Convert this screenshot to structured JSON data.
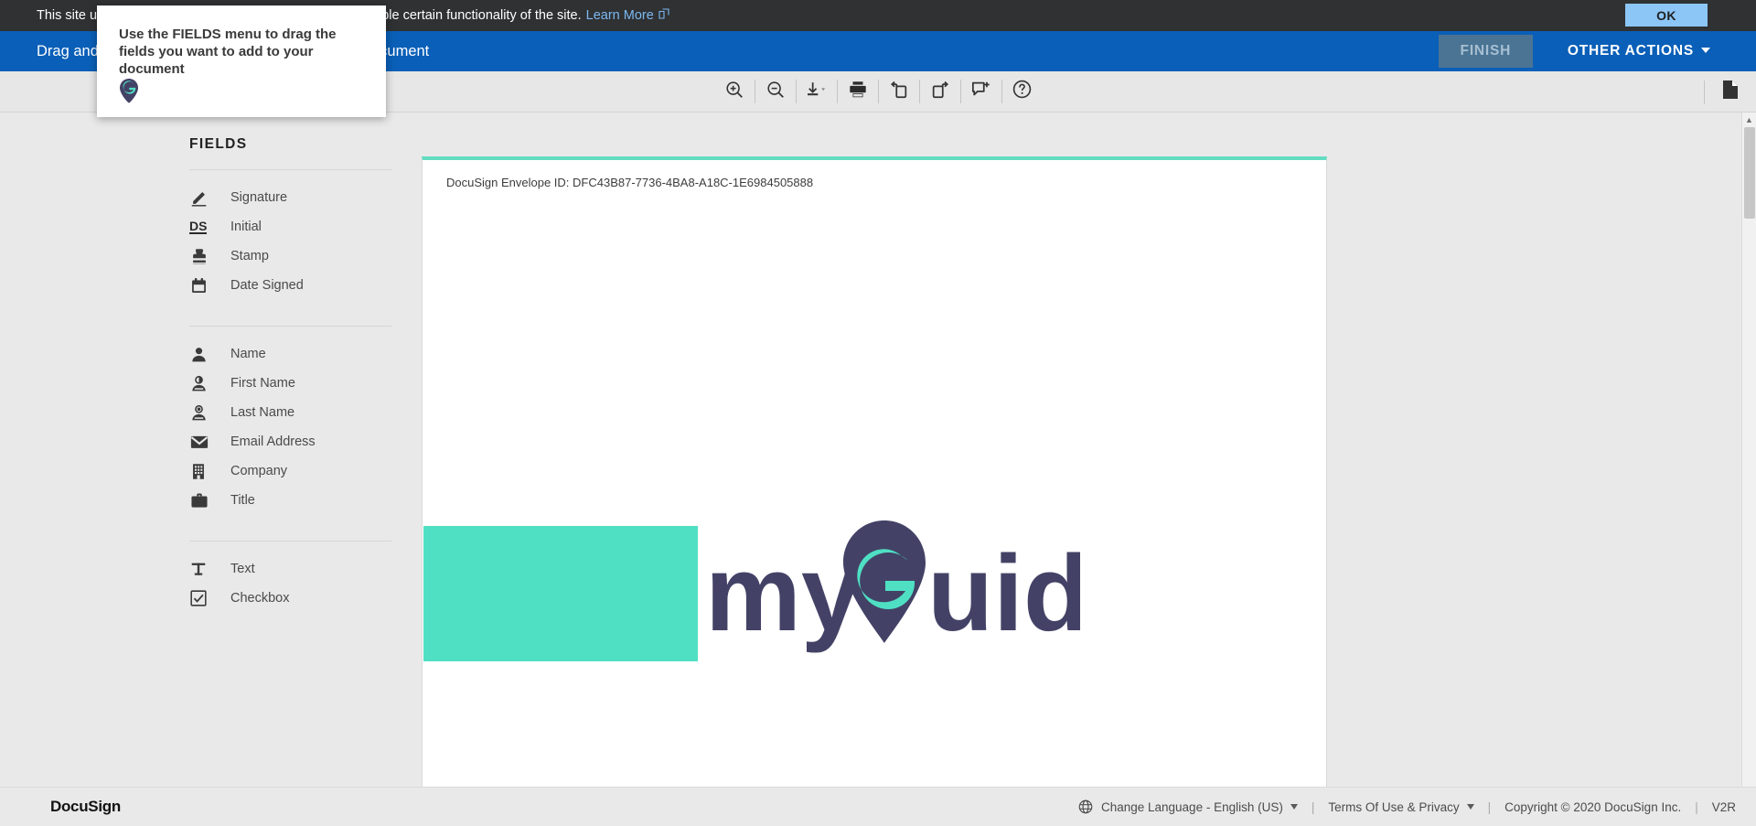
{
  "cookie_banner": {
    "text": "This site uses cookies to improve your experience and enable certain functionality of the site.",
    "link_label": "Learn More",
    "link_icon": "external-link-icon",
    "ok_label": "OK",
    "background": "#2f3133",
    "ok_background": "#8cc6f7"
  },
  "header": {
    "title": "Drag and drop the fields you want to add to your document",
    "finish_label": "FINISH",
    "other_actions_label": "OTHER ACTIONS",
    "background": "#0a5fb8",
    "finish_background": "#4b7494"
  },
  "toolbar": {
    "items": [
      {
        "name": "zoom-in-icon",
        "title": "Zoom In"
      },
      {
        "name": "zoom-out-icon",
        "title": "Zoom Out"
      },
      {
        "name": "download-icon",
        "title": "Download"
      },
      {
        "name": "print-icon",
        "title": "Print"
      },
      {
        "name": "rotate-left-icon",
        "title": "Rotate Left"
      },
      {
        "name": "rotate-right-icon",
        "title": "Rotate Right"
      },
      {
        "name": "add-comment-icon",
        "title": "Add Comment"
      },
      {
        "name": "help-icon",
        "title": "Help"
      }
    ],
    "page_toggle_icon": "document-page-icon"
  },
  "sidebar": {
    "title": "FIELDS",
    "groups": [
      {
        "items": [
          {
            "label": "Signature",
            "icon": "signature-pen-icon"
          },
          {
            "label": "Initial",
            "icon": "initial-ds-icon"
          },
          {
            "label": "Stamp",
            "icon": "stamp-icon"
          },
          {
            "label": "Date Signed",
            "icon": "calendar-icon"
          }
        ]
      },
      {
        "items": [
          {
            "label": "Name",
            "icon": "person-icon"
          },
          {
            "label": "First Name",
            "icon": "person-first-name-icon"
          },
          {
            "label": "Last Name",
            "icon": "person-last-name-icon"
          },
          {
            "label": "Email Address",
            "icon": "envelope-icon"
          },
          {
            "label": "Company",
            "icon": "building-icon"
          },
          {
            "label": "Title",
            "icon": "briefcase-icon"
          }
        ]
      },
      {
        "items": [
          {
            "label": "Text",
            "icon": "text-t-icon"
          },
          {
            "label": "Checkbox",
            "icon": "checkbox-icon"
          }
        ]
      }
    ],
    "initial_glyph": "DS"
  },
  "document": {
    "envelope_id": "DocuSign Envelope ID: DFC43B87-7736-4BA8-A18C-1E6984505888",
    "top_border_color": "#63ddc2",
    "logo": {
      "rect_color": "#4fe0c4",
      "text_color": "#434266",
      "accent_color": "#4fe0c4",
      "word_prefix": "my",
      "word_suffix": "uide",
      "pin_letter": "G"
    }
  },
  "tooltip": {
    "text": "Use the FIELDS menu to drag the fields you want to add to your document",
    "pin_icon": "myguide-pin-icon",
    "pin_letter": "G"
  },
  "footer": {
    "logo": "DocuSign",
    "language_label": "Change Language - English (US)",
    "language_icon": "globe-icon",
    "terms_label": "Terms Of Use & Privacy",
    "copyright": "Copyright © 2020 DocuSign Inc.",
    "version": "V2R",
    "separator": "|"
  }
}
